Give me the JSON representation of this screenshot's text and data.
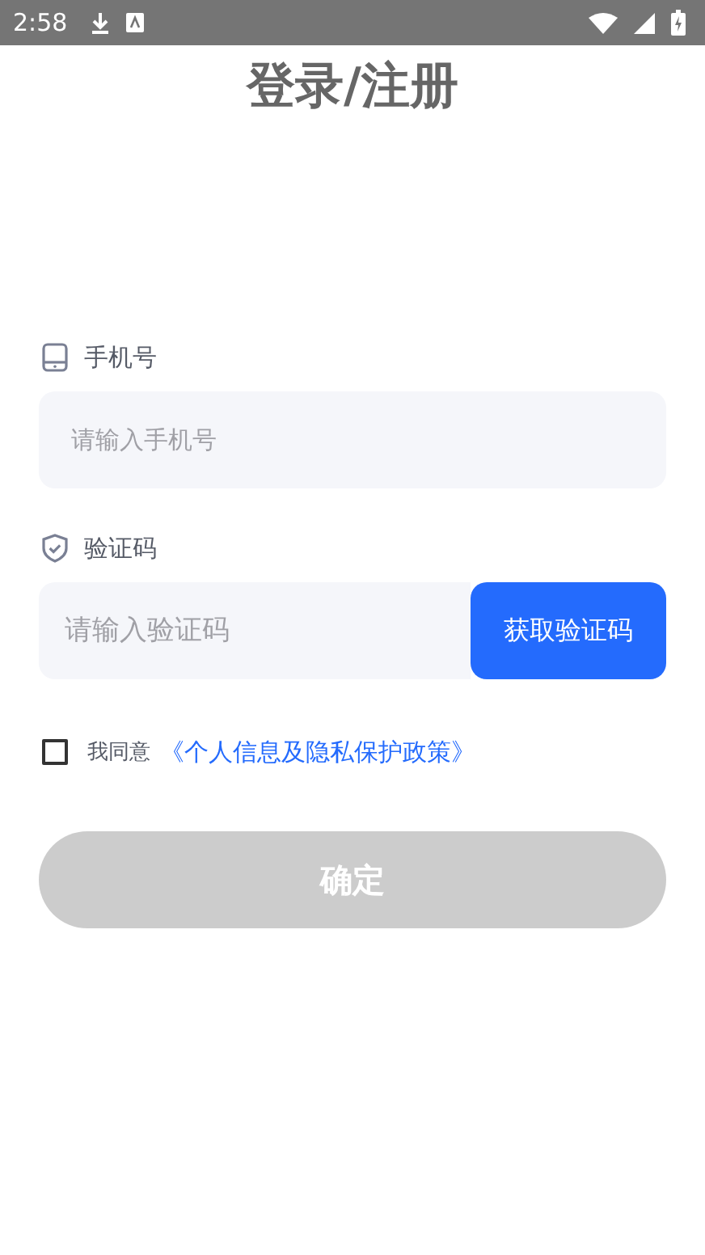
{
  "status_bar": {
    "time": "2:58"
  },
  "title": "登录/注册",
  "phone": {
    "label": "手机号",
    "placeholder": "请输入手机号"
  },
  "code": {
    "label": "验证码",
    "placeholder": "请输入验证码",
    "button": "获取验证码"
  },
  "agreement": {
    "checked": false,
    "text": "我同意",
    "link": "《个人信息及隐私保护政策》"
  },
  "confirm_button": {
    "label": "确定",
    "disabled": true
  }
}
